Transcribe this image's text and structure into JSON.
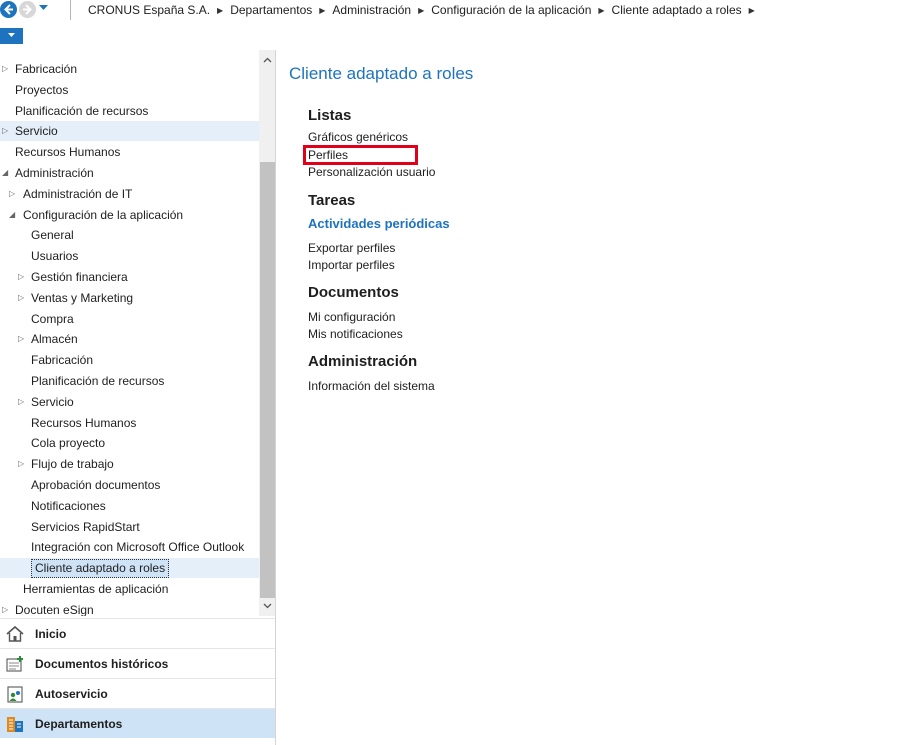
{
  "breadcrumb": [
    "CRONUS España S.A.",
    "Departamentos",
    "Administración",
    "Configuración de la aplicación",
    "Cliente adaptado a roles"
  ],
  "tree": [
    {
      "label": "Fabricación",
      "arrow": true,
      "indent": 0,
      "highlight": false
    },
    {
      "label": "Proyectos",
      "arrow": false,
      "indent": 0,
      "highlight": false
    },
    {
      "label": "Planificación de recursos",
      "arrow": false,
      "indent": 0,
      "highlight": false
    },
    {
      "label": "Servicio",
      "arrow": true,
      "indent": 0,
      "highlight": true
    },
    {
      "label": "Recursos Humanos",
      "arrow": false,
      "indent": 0,
      "highlight": false
    },
    {
      "label": "Administración",
      "arrow": true,
      "expanded": true,
      "indent": 0,
      "highlight": false
    },
    {
      "label": "Administración de IT",
      "arrow": true,
      "indent": 1,
      "highlight": false
    },
    {
      "label": "Configuración de la aplicación",
      "arrow": true,
      "expanded": true,
      "indent": 1,
      "highlight": false
    },
    {
      "label": "General",
      "arrow": false,
      "indent": 2,
      "highlight": false
    },
    {
      "label": "Usuarios",
      "arrow": false,
      "indent": 2,
      "highlight": false
    },
    {
      "label": "Gestión financiera",
      "arrow": true,
      "indent": 2,
      "highlight": false
    },
    {
      "label": "Ventas y Marketing",
      "arrow": true,
      "indent": 2,
      "highlight": false
    },
    {
      "label": "Compra",
      "arrow": false,
      "indent": 2,
      "highlight": false
    },
    {
      "label": "Almacén",
      "arrow": true,
      "indent": 2,
      "highlight": false
    },
    {
      "label": "Fabricación",
      "arrow": false,
      "indent": 2,
      "highlight": false
    },
    {
      "label": "Planificación de recursos",
      "arrow": false,
      "indent": 2,
      "highlight": false
    },
    {
      "label": "Servicio",
      "arrow": true,
      "indent": 2,
      "highlight": false
    },
    {
      "label": "Recursos Humanos",
      "arrow": false,
      "indent": 2,
      "highlight": false
    },
    {
      "label": "Cola proyecto",
      "arrow": false,
      "indent": 2,
      "highlight": false
    },
    {
      "label": "Flujo de trabajo",
      "arrow": true,
      "indent": 2,
      "highlight": false
    },
    {
      "label": "Aprobación documentos",
      "arrow": false,
      "indent": 2,
      "highlight": false
    },
    {
      "label": "Notificaciones",
      "arrow": false,
      "indent": 2,
      "highlight": false
    },
    {
      "label": "Servicios RapidStart",
      "arrow": false,
      "indent": 2,
      "highlight": false
    },
    {
      "label": "Integración con Microsoft Office Outlook",
      "arrow": false,
      "indent": 2,
      "highlight": false
    },
    {
      "label": "Cliente adaptado a roles",
      "arrow": false,
      "indent": 2,
      "highlight": true,
      "selected": true
    },
    {
      "label": "Herramientas de aplicación",
      "arrow": false,
      "indent": 1,
      "highlight": false
    },
    {
      "label": "Docuten eSign",
      "arrow": true,
      "indent": 0,
      "highlight": false
    }
  ],
  "nav_buttons": [
    {
      "label": "Inicio",
      "icon": "home-icon",
      "active": false
    },
    {
      "label": "Documentos históricos",
      "icon": "history-documents-icon",
      "active": false
    },
    {
      "label": "Autoservicio",
      "icon": "self-service-icon",
      "active": false
    },
    {
      "label": "Departamentos",
      "icon": "departments-icon",
      "active": true
    }
  ],
  "content": {
    "title": "Cliente adaptado a roles",
    "sections": [
      {
        "heading": "Listas",
        "links": [
          "Gráficos genéricos",
          "Perfiles",
          "Personalización usuario"
        ]
      },
      {
        "heading": "Tareas",
        "links": [
          "Actividades periódicas",
          "Exportar perfiles",
          "Importar perfiles"
        ]
      },
      {
        "heading": "Documentos",
        "links": [
          "Mi configuración",
          "Mis notificaciones"
        ]
      },
      {
        "heading": "Administración",
        "links": [
          "Información del sistema"
        ]
      }
    ]
  },
  "colors": {
    "accent": "#1e73be",
    "highlight_box": "#e0001a",
    "selection": "#cfe3f6"
  }
}
